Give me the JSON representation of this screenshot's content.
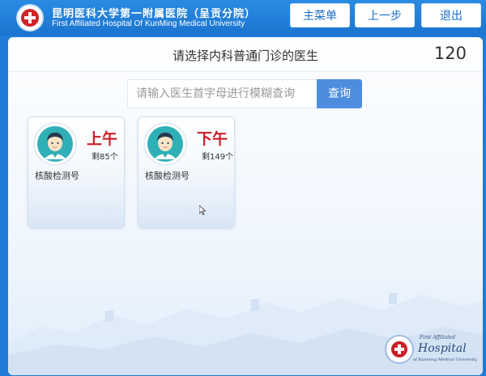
{
  "header": {
    "hospital_name_cn": "昆明医科大学第一附属医院（呈贡分院）",
    "hospital_name_en": "First Affiliated Hospital Of KunMing Medical University",
    "buttons": {
      "main_menu": "主菜单",
      "back": "上一步",
      "exit": "退出"
    },
    "logo_icon": "hospital-cross-logo"
  },
  "main": {
    "title": "请选择内科普通门诊的医生",
    "countdown": "120",
    "search": {
      "placeholder": "请输入医生首字母进行模糊查询",
      "value": "",
      "button_label": "查询"
    },
    "doctors": [
      {
        "period": "上午",
        "remaining": "剩85个",
        "name": "核酸检测号",
        "avatar_icon": "doctor-avatar-icon"
      },
      {
        "period": "下午",
        "remaining": "剩149个",
        "name": "核酸检测号",
        "avatar_icon": "doctor-avatar-icon"
      }
    ]
  },
  "footer": {
    "logo_small": "First Affiliated",
    "logo_big": "Hospital",
    "logo_sub": "of Kunming Medical University"
  },
  "colors": {
    "header_blue": "#1e7cd6",
    "accent_red": "#c8202a",
    "search_button": "#4c8dde"
  }
}
